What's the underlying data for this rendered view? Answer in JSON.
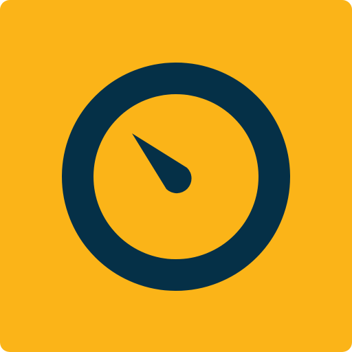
{
  "icon": {
    "name": "gauge-icon",
    "colors": {
      "background": "#FBB418",
      "foreground": "#053047"
    }
  }
}
